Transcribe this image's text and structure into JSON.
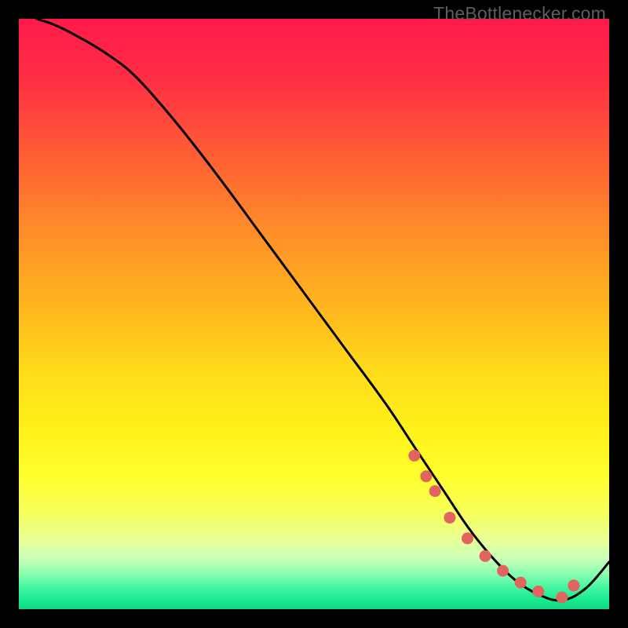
{
  "watermark": "TheBottlenecker.com",
  "gradient_stops": [
    {
      "offset": 0.0,
      "color": "#ff1a4a"
    },
    {
      "offset": 0.1,
      "color": "#ff2e44"
    },
    {
      "offset": 0.22,
      "color": "#ff5a36"
    },
    {
      "offset": 0.35,
      "color": "#ff8a2a"
    },
    {
      "offset": 0.48,
      "color": "#ffb41f"
    },
    {
      "offset": 0.6,
      "color": "#ffdc1a"
    },
    {
      "offset": 0.7,
      "color": "#fff21a"
    },
    {
      "offset": 0.78,
      "color": "#ffff30"
    },
    {
      "offset": 0.84,
      "color": "#f6ff60"
    },
    {
      "offset": 0.885,
      "color": "#e8ff9a"
    },
    {
      "offset": 0.915,
      "color": "#c8ffb8"
    },
    {
      "offset": 0.94,
      "color": "#88ffb0"
    },
    {
      "offset": 0.965,
      "color": "#40f5a0"
    },
    {
      "offset": 0.985,
      "color": "#18e890"
    },
    {
      "offset": 1.0,
      "color": "#10d884"
    }
  ],
  "chart_data": {
    "type": "line",
    "title": "",
    "xlabel": "",
    "ylabel": "",
    "xlim": [
      0,
      100
    ],
    "ylim": [
      0,
      100
    ],
    "series": [
      {
        "name": "curve",
        "x": [
          3,
          6,
          10,
          15,
          20,
          27,
          34,
          41,
          48,
          55,
          62,
          67,
          72,
          76,
          80,
          84,
          88,
          92,
          96,
          100
        ],
        "y": [
          100,
          99,
          97,
          94,
          90,
          82,
          73,
          63.5,
          54,
          44.5,
          35,
          27.5,
          20,
          14,
          9,
          5,
          2.5,
          1.5,
          3.5,
          8
        ]
      }
    ],
    "markers": {
      "name": "dots",
      "x": [
        67,
        69,
        70.5,
        73,
        76,
        79,
        82,
        85,
        88,
        92,
        94
      ],
      "y": [
        26,
        22.5,
        20,
        15.5,
        12,
        9,
        6.5,
        4.5,
        3,
        2,
        4
      ]
    },
    "marker_color": "#e2645f",
    "curve_color": "#000000"
  }
}
